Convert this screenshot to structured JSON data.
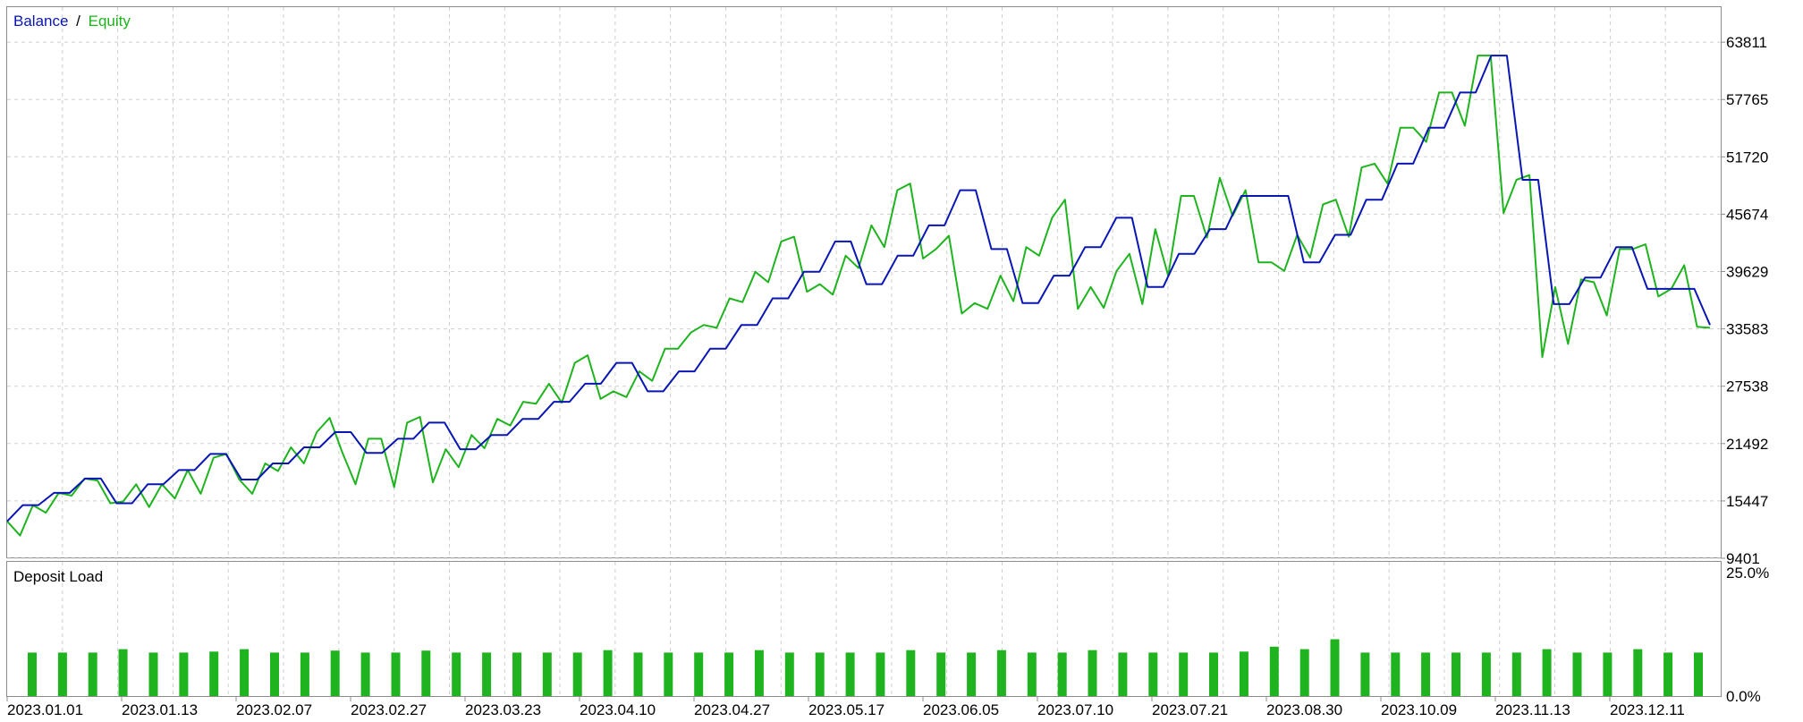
{
  "chart_data": [
    {
      "type": "line",
      "title": "",
      "legend": [
        {
          "label": "Balance",
          "color": "#0a16b4"
        },
        {
          "label": "Equity",
          "color": "#1fb41f"
        }
      ],
      "legend_separator": "/",
      "legend_position": "top-left",
      "grid": true,
      "y_ticks": [
        "63811",
        "57765",
        "51720",
        "45674",
        "39629",
        "33583",
        "27538",
        "21492",
        "15447",
        "9401"
      ],
      "ylim": [
        9401,
        67500
      ],
      "x_count": 124,
      "x_tick_labels": [
        "2023.01.01",
        "2023.01.13",
        "2023.02.07",
        "2023.02.27",
        "2023.03.23",
        "2023.04.10",
        "2023.04.27",
        "2023.05.17",
        "2023.06.05",
        "2023.07.10",
        "2023.07.21",
        "2023.08.30",
        "2023.10.09",
        "2023.11.13",
        "2023.12.11"
      ],
      "series": [
        {
          "name": "Balance",
          "color": "#0a16b4",
          "values": [
            13300,
            15000,
            15000,
            16300,
            16300,
            17800,
            17800,
            15200,
            15200,
            17200,
            17200,
            18700,
            18700,
            20400,
            20400,
            17700,
            17700,
            19400,
            19400,
            21100,
            21100,
            22700,
            22700,
            20500,
            20500,
            22000,
            22000,
            23700,
            23700,
            20900,
            20900,
            22400,
            22400,
            24100,
            24100,
            25900,
            25900,
            27800,
            27800,
            30000,
            30000,
            27000,
            27000,
            29100,
            29100,
            31500,
            31500,
            34000,
            34000,
            36800,
            36800,
            39600,
            39600,
            42800,
            42800,
            38300,
            38300,
            41300,
            41300,
            44500,
            44500,
            48200,
            48200,
            42000,
            42000,
            36300,
            36300,
            39200,
            39200,
            42200,
            42200,
            45300,
            45300,
            38000,
            38000,
            41500,
            41500,
            44100,
            44100,
            47600,
            47600,
            47600,
            47600,
            40600,
            40600,
            43500,
            43500,
            47200,
            47200,
            51000,
            51000,
            54800,
            54800,
            58500,
            58500,
            62400,
            62400,
            49300,
            49300,
            36200,
            36200,
            39000,
            39000,
            42200,
            42200,
            37800,
            37800,
            37800,
            37800,
            34000
          ]
        },
        {
          "name": "Equity",
          "color": "#1fb41f",
          "values": [
            13300,
            11800,
            15000,
            14200,
            16300,
            16000,
            17800,
            17600,
            15200,
            15400,
            17200,
            14800,
            17200,
            15700,
            18700,
            16200,
            20000,
            20400,
            17700,
            16200,
            19400,
            18600,
            21100,
            19400,
            22700,
            24200,
            20500,
            17200,
            22000,
            22000,
            16900,
            23700,
            24300,
            17400,
            20900,
            19000,
            22400,
            21000,
            24100,
            23400,
            25900,
            25700,
            27800,
            25800,
            30000,
            30800,
            26200,
            27000,
            26400,
            29100,
            28100,
            31500,
            31500,
            33200,
            34000,
            33700,
            36800,
            36400,
            39600,
            38500,
            42800,
            43300,
            37500,
            38300,
            37200,
            41300,
            40000,
            44500,
            42200,
            48200,
            48900,
            41000,
            42000,
            43400,
            35200,
            36300,
            35700,
            39200,
            36500,
            42200,
            41300,
            45300,
            47200,
            35700,
            38000,
            35800,
            39700,
            41500,
            36200,
            44100,
            39200,
            47600,
            47600,
            43200,
            49500,
            45500,
            48200,
            40600,
            40600,
            39700,
            43500,
            41100,
            46700,
            47200,
            43300,
            50600,
            51000,
            48900,
            54800,
            54800,
            53300,
            58500,
            58500,
            55000,
            62400,
            62400,
            45800,
            49300,
            49800,
            30600,
            38000,
            32000,
            38800,
            38500,
            35000,
            42000,
            42000,
            42500,
            37000,
            37800,
            40300,
            33800,
            33700
          ]
        }
      ]
    },
    {
      "type": "bar",
      "title": "Deposit Load",
      "y_ticks": [
        "25.0%",
        "0.0%"
      ],
      "ylim": [
        0,
        25
      ],
      "values": [
        8.8,
        8.8,
        8.8,
        9.5,
        8.8,
        8.8,
        9.0,
        9.5,
        8.8,
        8.8,
        9.2,
        8.8,
        8.8,
        9.2,
        8.8,
        8.8,
        8.8,
        8.8,
        8.8,
        9.3,
        8.8,
        8.8,
        8.8,
        8.8,
        9.3,
        8.8,
        8.8,
        8.8,
        8.8,
        9.3,
        8.8,
        8.8,
        9.3,
        8.8,
        8.8,
        9.3,
        8.8,
        8.8,
        8.8,
        8.8,
        9.0,
        10.0,
        9.5,
        11.5,
        8.8,
        8.8,
        8.8,
        8.8,
        8.8,
        8.8,
        9.5,
        8.8,
        8.8,
        9.5,
        8.8,
        8.8
      ]
    }
  ]
}
